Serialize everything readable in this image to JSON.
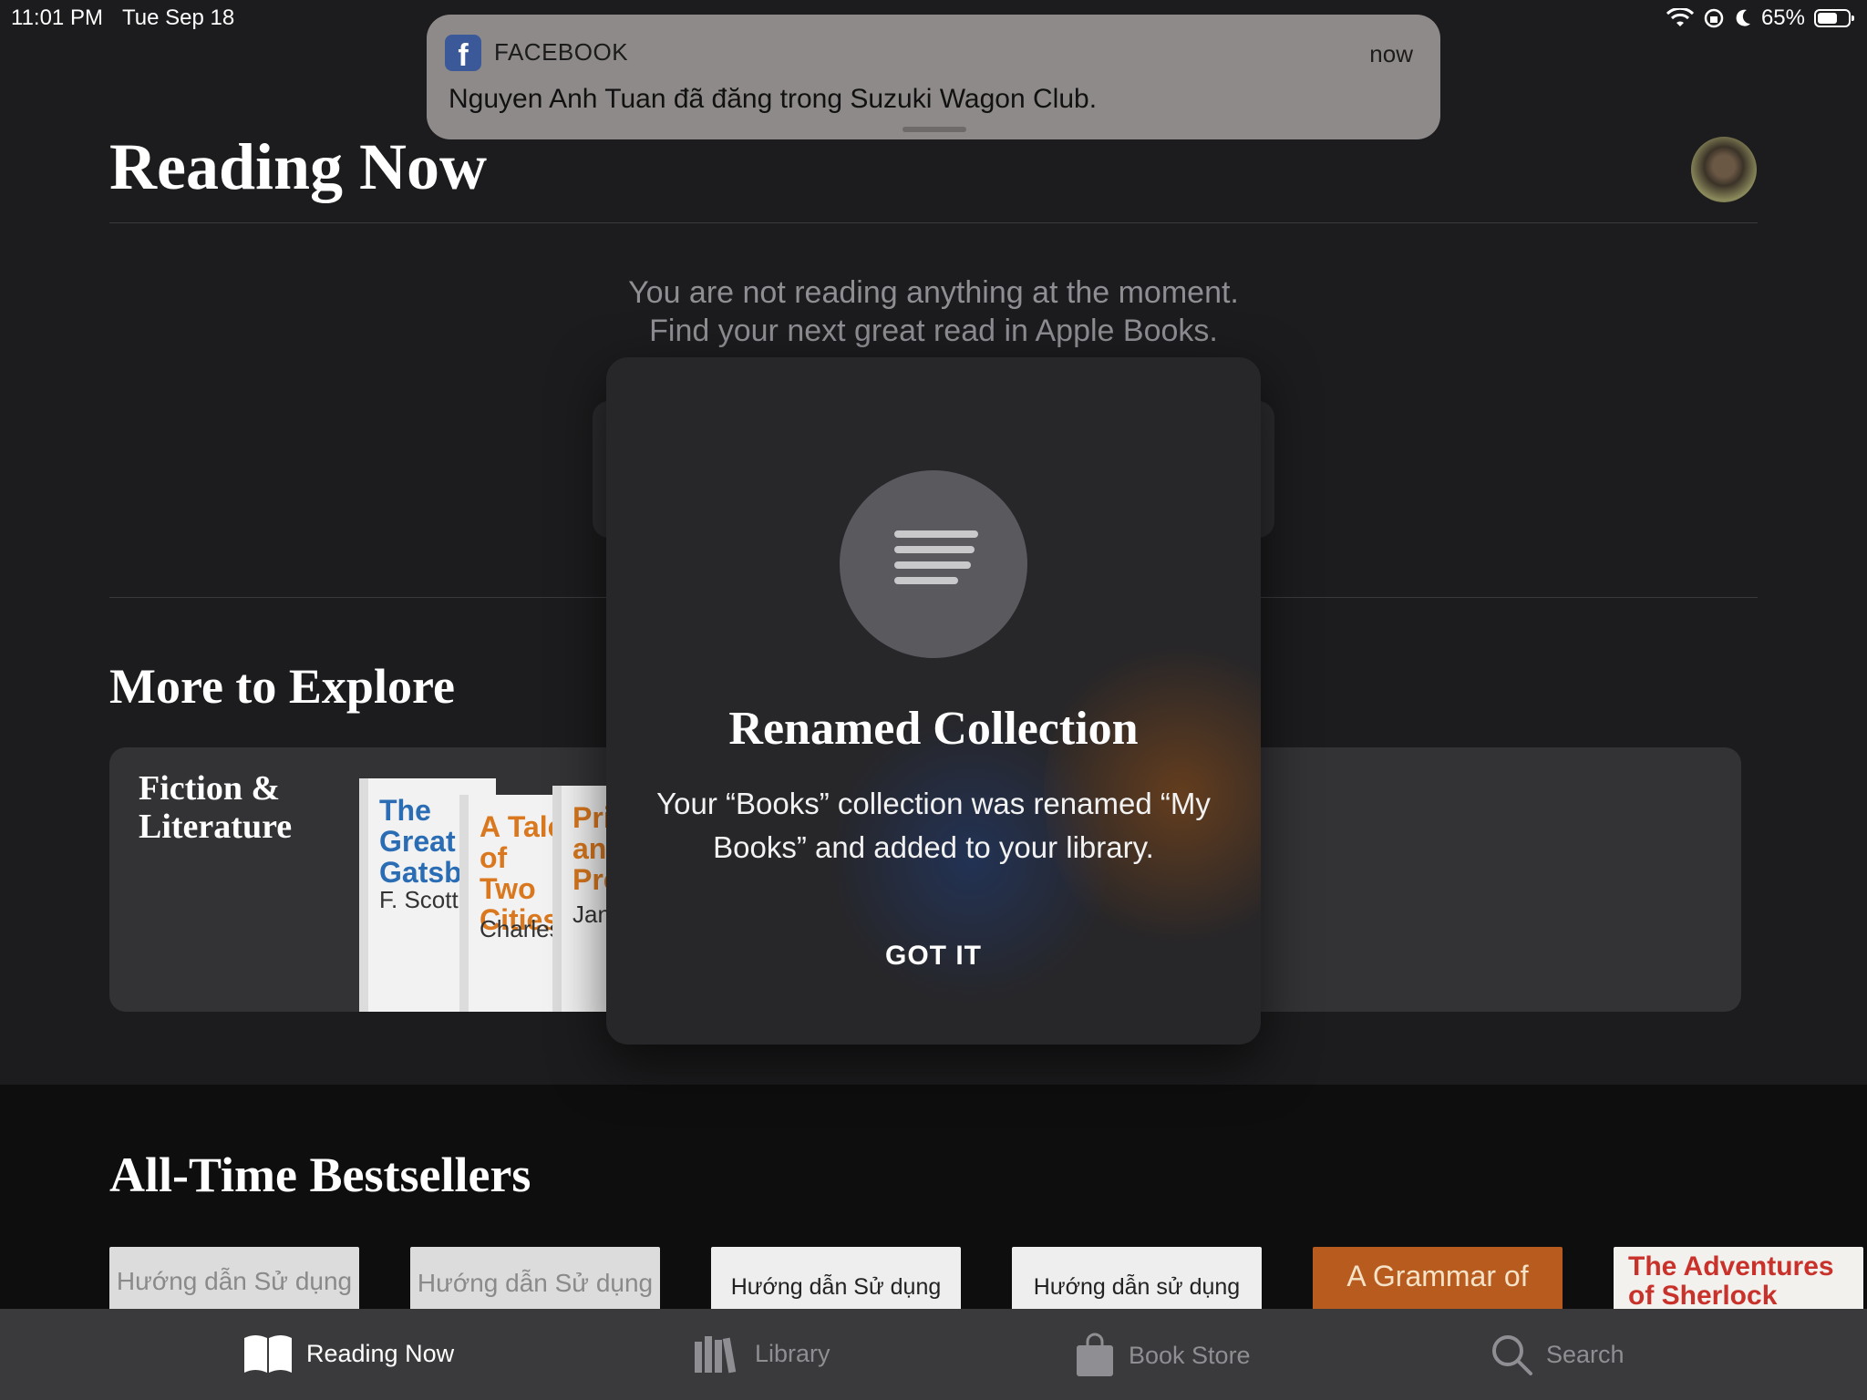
{
  "status": {
    "time": "11:01 PM",
    "date": "Tue Sep 18",
    "battery": "65%",
    "battery_level": 0.65
  },
  "notification": {
    "app": "FACEBOOK",
    "time": "now",
    "message": "Nguyen Anh Tuan đã đăng trong Suzuki Wagon Club.",
    "icon_letter": "f"
  },
  "reading_now": {
    "title": "Reading Now",
    "empty_line1": "You are not reading anything at the moment.",
    "empty_line2": "Find your next great read in Apple Books."
  },
  "explore": {
    "title": "More to Explore",
    "card_label": "Fiction &\nLiterature",
    "books": [
      {
        "title": "The Great\nGatsby",
        "author": "F. Scott",
        "color": "#2a6db5"
      },
      {
        "title": "A Tale of\nTwo Cities",
        "author": "Charles",
        "color": "#d9781e"
      },
      {
        "title": "Pride and\nPrejudice",
        "author": "Jane",
        "color": "#d9781e"
      }
    ]
  },
  "bestsellers": {
    "title": "All-Time Bestsellers",
    "books": [
      {
        "title": "Hướng dẫn Sử dụng"
      },
      {
        "title": "Hướng dẫn Sử dụng"
      },
      {
        "title": "Hướng dẫn Sử dụng"
      },
      {
        "title": "Hướng dẫn sử dụng"
      },
      {
        "title": "A Grammar of"
      },
      {
        "title": "The Adventures of Sherlock"
      }
    ]
  },
  "tabs": [
    {
      "label": "Reading Now",
      "icon": "book-open-icon",
      "active": true
    },
    {
      "label": "Library",
      "icon": "library-icon",
      "active": false
    },
    {
      "label": "Book Store",
      "icon": "shopping-bag-icon",
      "active": false
    },
    {
      "label": "Search",
      "icon": "search-icon",
      "active": false
    }
  ],
  "modal": {
    "title": "Renamed Collection",
    "body": "Your “Books” collection was renamed “My Books” and added to your library.",
    "button": "GOT IT",
    "icon": "collection-lines-icon"
  },
  "colors": {
    "background": "#1c1b1d",
    "tabbar": "#3a393b",
    "facebook": "#3b5998"
  }
}
